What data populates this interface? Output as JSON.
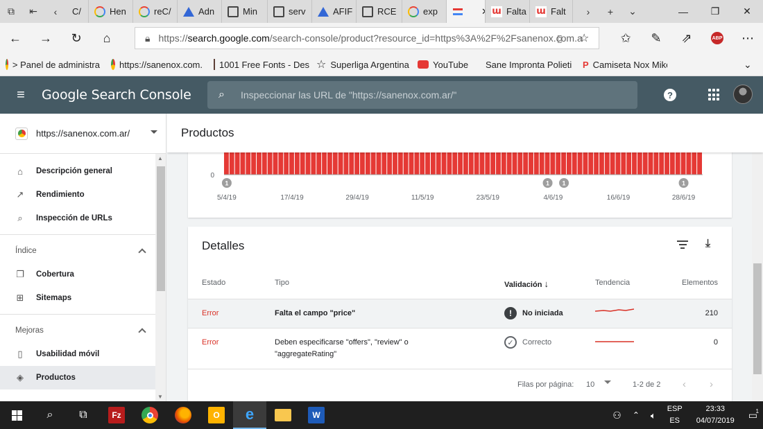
{
  "browser": {
    "tabs": [
      {
        "label": "C/",
        "icon": "page-icon"
      },
      {
        "label": "Hen",
        "icon": "google-icon"
      },
      {
        "label": "reC/",
        "icon": "google-icon"
      },
      {
        "label": "Adn",
        "icon": "drive-icon"
      },
      {
        "label": "Min",
        "icon": "page-icon"
      },
      {
        "label": "serv",
        "icon": "page-icon"
      },
      {
        "label": "AFIF",
        "icon": "drive-icon"
      },
      {
        "label": "RCE",
        "icon": "page-icon"
      },
      {
        "label": "exp",
        "icon": "google-icon"
      },
      {
        "label": "",
        "icon": "search-console-icon",
        "active": true
      },
      {
        "label": "Falta",
        "icon": "w-icon"
      },
      {
        "label": "Falt",
        "icon": "w-icon"
      }
    ],
    "url_prefix": "https://",
    "url_host": "search.google.com",
    "url_rest": "/search-console/product?resource_id=https%3A%2F%2Fsanenox.com.a",
    "favorites": [
      {
        "label": "> Panel de administra",
        "icon": "sanenox-icon"
      },
      {
        "label": "https://sanenox.com.",
        "icon": "sanenox-icon"
      },
      {
        "label": "1001 Free Fonts - Des",
        "icon": "fonts-icon"
      },
      {
        "label": "Superliga Argentina F",
        "icon": "star-icon"
      },
      {
        "label": "YouTube",
        "icon": "youtube-icon"
      },
      {
        "label": "Sane Impronta Polieti",
        "icon": "sane-icon"
      },
      {
        "label": "Camiseta Nox Mike -",
        "icon": "p-icon"
      }
    ],
    "abp_label": "ABP"
  },
  "gsc": {
    "logo": "Google Search Console",
    "search_placeholder": "Inspeccionar las URL de \"https://sanenox.com.ar/\"",
    "help_label": "?"
  },
  "sidebar": {
    "property": "https://sanenox.com.ar/",
    "items_top": [
      {
        "label": "Descripción general",
        "icon": "home-icon"
      },
      {
        "label": "Rendimiento",
        "icon": "trending-icon"
      },
      {
        "label": "Inspección de URLs",
        "icon": "search-icon"
      }
    ],
    "section_index": "Índice",
    "items_index": [
      {
        "label": "Cobertura",
        "icon": "copy-icon"
      },
      {
        "label": "Sitemaps",
        "icon": "sitemap-icon"
      }
    ],
    "section_improve": "Mejoras",
    "items_improve": [
      {
        "label": "Usabilidad móvil",
        "icon": "phone-icon"
      },
      {
        "label": "Productos",
        "icon": "layers-icon",
        "active": true
      }
    ]
  },
  "main": {
    "page_title": "Productos",
    "details_title": "Detalles",
    "columns": {
      "status": "Estado",
      "type": "Tipo",
      "validation": "Validación",
      "trend": "Tendencia",
      "items": "Elementos"
    },
    "rows": [
      {
        "status": "Error",
        "type_line1": "Falta el campo \"price\"",
        "type_line2": "",
        "validation": "No iniciada",
        "items": "210"
      },
      {
        "status": "Error",
        "type_line1": "Deben especificarse \"offers\", \"review\" o",
        "type_line2": "\"aggregateRating\"",
        "validation": "Correcto",
        "items": "0"
      }
    ],
    "pager": {
      "rows_label": "Filas por página:",
      "rows_value": "10",
      "range": "1-2 de 2"
    }
  },
  "chart_data": {
    "type": "bar",
    "color": "#e53935",
    "y_tick_label": "0",
    "x_ticks": [
      "5/4/19",
      "17/4/19",
      "29/4/19",
      "11/5/19",
      "23/5/19",
      "4/6/19",
      "16/6/19",
      "28/6/19"
    ],
    "bar_count": 88,
    "annotations": [
      {
        "label": "1",
        "date": "5/4/19"
      },
      {
        "label": "1",
        "date": "3/6/19"
      },
      {
        "label": "1",
        "date": "6/6/19"
      },
      {
        "label": "1",
        "date": "28/6/19"
      }
    ]
  },
  "taskbar": {
    "lang_line1": "ESP",
    "lang_line2": "ES",
    "time": "23:33",
    "date": "04/07/2019",
    "notif_count": "1"
  }
}
